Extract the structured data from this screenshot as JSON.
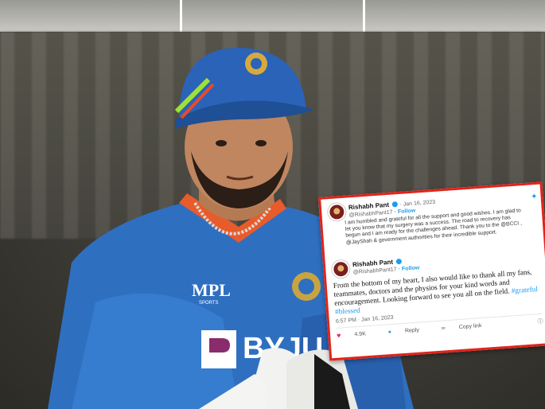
{
  "tweet_card": {
    "quoted": {
      "name": "Rishabh Pant",
      "handle": "@RishabhPant17",
      "date": "· Jan 16, 2023",
      "follow": "· Follow",
      "text": "I am humbled and grateful for all the support and good wishes. I am glad to let you know that my surgery was a success. The road to recovery has begun and I am ready for the challenges ahead. Thank you to the @BCCI , @JayShah & government authorities for their incredible support."
    },
    "main": {
      "name": "Rishabh Pant",
      "handle": "@RishabhPant17",
      "follow": "· Follow",
      "text_part1": "From the bottom of my heart, I also would like to thank all my fans, teammates, doctors and the physios for your kind words and encouragement. Looking forward to see you all on the field. ",
      "hashtags": "#grateful #blessed",
      "timestamp": "6:57 PM · Jan 16, 2023",
      "likes": "4.9K",
      "reply_label": "Reply",
      "copy_link_label": "Copy link"
    }
  },
  "colors": {
    "border": "#e2231a",
    "twitter_blue": "#1d9bf0"
  },
  "icons": [
    "twitter-bird-icon",
    "verified-icon",
    "heart-icon",
    "reply-icon",
    "link-icon",
    "info-icon"
  ]
}
